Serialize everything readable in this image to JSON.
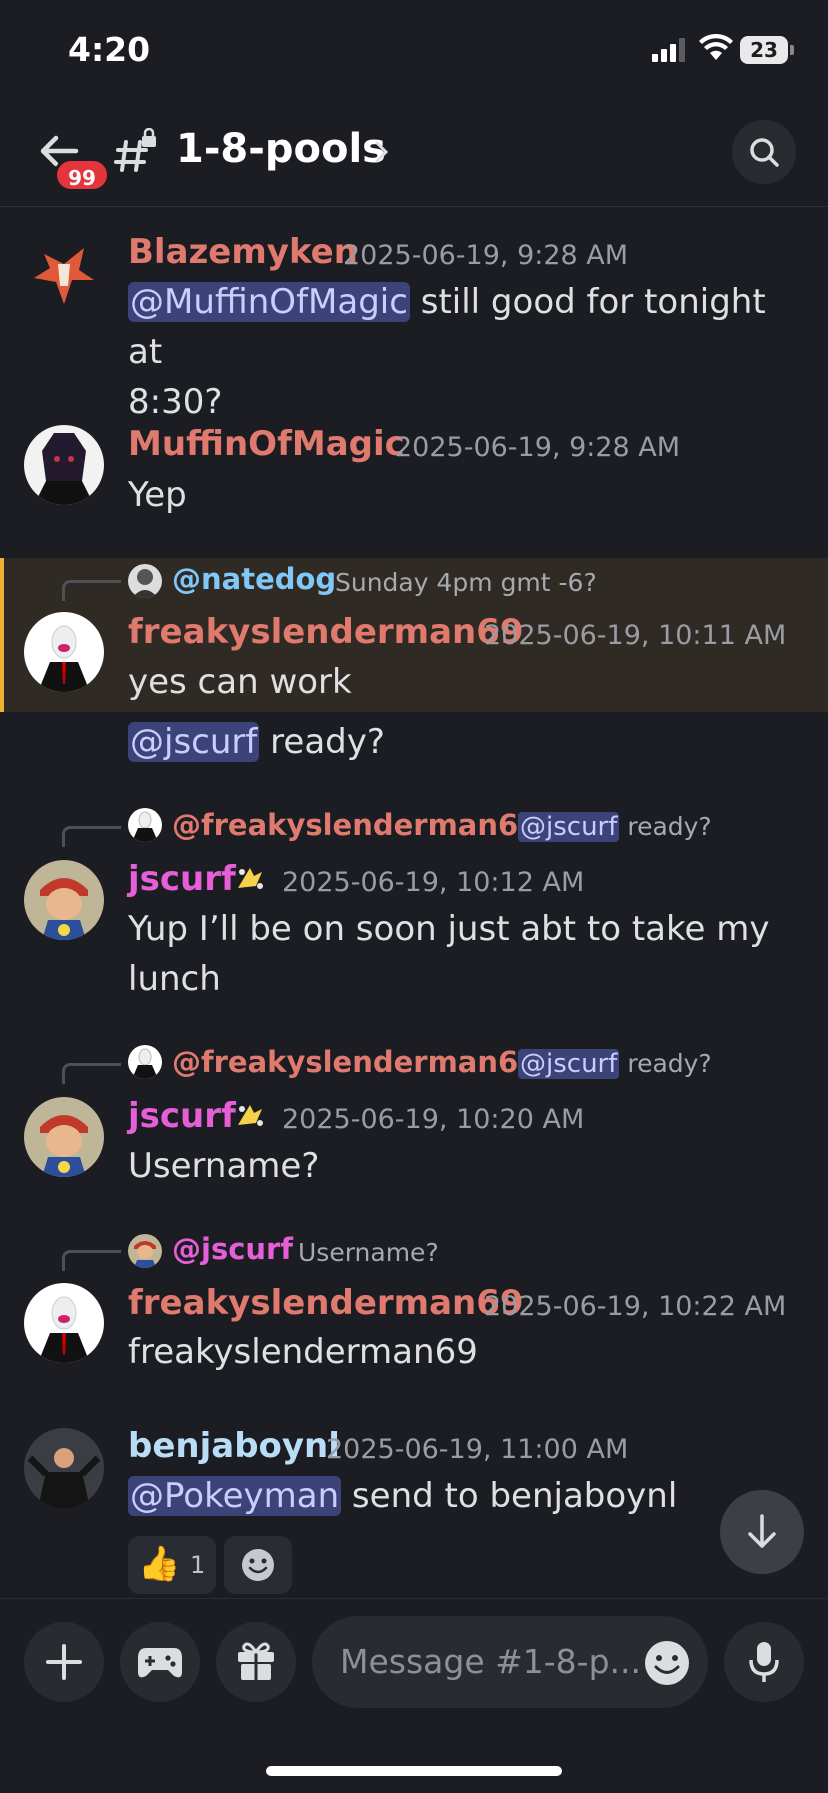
{
  "status_bar": {
    "time": "4:20",
    "battery": "23"
  },
  "header": {
    "unread_badge": "99",
    "channel_name": "1-8-pools",
    "back_icon": "arrow-left-icon",
    "search_icon": "search-icon"
  },
  "messages": [
    {
      "author": "Blazemyken",
      "author_color": "#e07a6e",
      "timestamp": "2025-06-19, 9:28 AM",
      "mention": "@MuffinOfMagic",
      "text_line1": " still good for tonight at",
      "text_line2": "8:30?"
    },
    {
      "author": "MuffinOfMagic",
      "author_color": "#e07a6e",
      "timestamp": "2025-06-19, 9:28 AM",
      "text": "Yep"
    },
    {
      "reply_to": "@natedog",
      "reply_to_color": "#7fc8f8",
      "reply_text": "Sunday 4pm gmt -6?",
      "author": "freakyslenderman69",
      "author_color": "#e07a6e",
      "timestamp": "2025-06-19, 10:11 AM",
      "text": "yes can work"
    },
    {
      "mention": "@jscurf",
      "text": " ready?"
    },
    {
      "reply_to": "@freakyslenderman69",
      "reply_to_color": "#e07a6e",
      "reply_mention": "@jscurf",
      "reply_text": " ready?",
      "author": "jscurf",
      "author_color": "#e65fd9",
      "timestamp": "2025-06-19, 10:12 AM",
      "text_line1": "Yup I’ll be on soon just abt to take my",
      "text_line2": "lunch"
    },
    {
      "reply_to": "@freakyslenderman69",
      "reply_to_color": "#e07a6e",
      "reply_mention": "@jscurf",
      "reply_text": " ready?",
      "author": "jscurf",
      "author_color": "#e65fd9",
      "timestamp": "2025-06-19, 10:20 AM",
      "text": "Username?"
    },
    {
      "reply_to": "@jscurf",
      "reply_to_color": "#e65fd9",
      "reply_text": "Username?",
      "author": "freakyslenderman69",
      "author_color": "#e07a6e",
      "timestamp": "2025-06-19, 10:22 AM",
      "text": "freakyslenderman69"
    },
    {
      "author": "benjaboynl",
      "author_color": "#b9dcf7",
      "timestamp": "2025-06-19, 11:00 AM",
      "mention": "@Pokeyman",
      "text": " send to benjaboynl",
      "reaction_emoji": "👍",
      "reaction_count": "1"
    }
  ],
  "composer": {
    "placeholder": "Message #1-8-p...",
    "plus_icon": "plus-icon",
    "game_icon": "gamepad-icon",
    "gift_icon": "gift-icon",
    "emoji_icon": "smile-icon",
    "mic_icon": "microphone-icon"
  }
}
